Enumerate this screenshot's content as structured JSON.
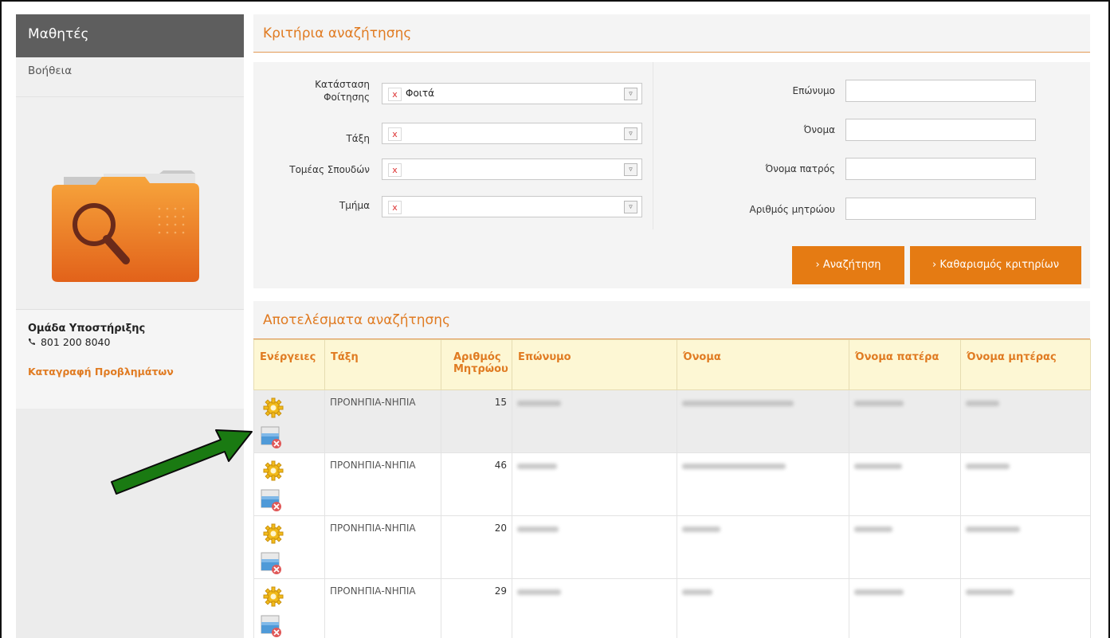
{
  "sidebar": {
    "title": "Μαθητές",
    "help": "Βοήθεια",
    "support_title": "Ομάδα Υποστήριξης",
    "phone": "801 200 8040",
    "report_link": "Καταγραφή Προβλημάτων"
  },
  "criteria": {
    "title": "Κριτήρια αναζήτησης",
    "status_label_line1": "Κατάσταση",
    "status_label_line2": "Φοίτησης",
    "status_value": "Φοιτά",
    "class_label": "Τάξη",
    "class_value": "",
    "sector_label": "Τομέας Σπουδών",
    "sector_value": "",
    "section_label": "Τμήμα",
    "section_value": "",
    "clear_symbol": "x",
    "surname_label": "Επώνυμο",
    "name_label": "Όνομα",
    "father_label": "Όνομα πατρός",
    "registry_label": "Αριθμός μητρώου",
    "search_button": "› Αναζήτηση",
    "clear_button": "› Καθαρισμός κριτηρίων"
  },
  "results": {
    "title": "Αποτελέσματα αναζήτησης",
    "columns": {
      "actions": "Ενέργειες",
      "class": "Τάξη",
      "registry_line1": "Αριθμός",
      "registry_line2": "Μητρώου",
      "surname": "Επώνυμο",
      "name": "Όνομα",
      "father": "Όνομα πατέρα",
      "mother": "Όνομα μητέρας"
    },
    "rows": [
      {
        "class": "ΠΡΟΝΗΠΙΑ-ΝΗΠΙΑ",
        "registry": "15"
      },
      {
        "class": "ΠΡΟΝΗΠΙΑ-ΝΗΠΙΑ",
        "registry": "46"
      },
      {
        "class": "ΠΡΟΝΗΠΙΑ-ΝΗΠΙΑ",
        "registry": "20"
      },
      {
        "class": "ΠΡΟΝΗΠΙΑ-ΝΗΠΙΑ",
        "registry": "29"
      }
    ]
  },
  "colors": {
    "accent": "#e57b13",
    "sidebar_header": "#5e5e5e",
    "annotation_arrow": "#1a7a12"
  },
  "icons": [
    "phone-icon",
    "search-folder-icon",
    "gear-icon",
    "folder-delete-icon",
    "dropdown-arrow-icon",
    "annotation-arrow"
  ]
}
